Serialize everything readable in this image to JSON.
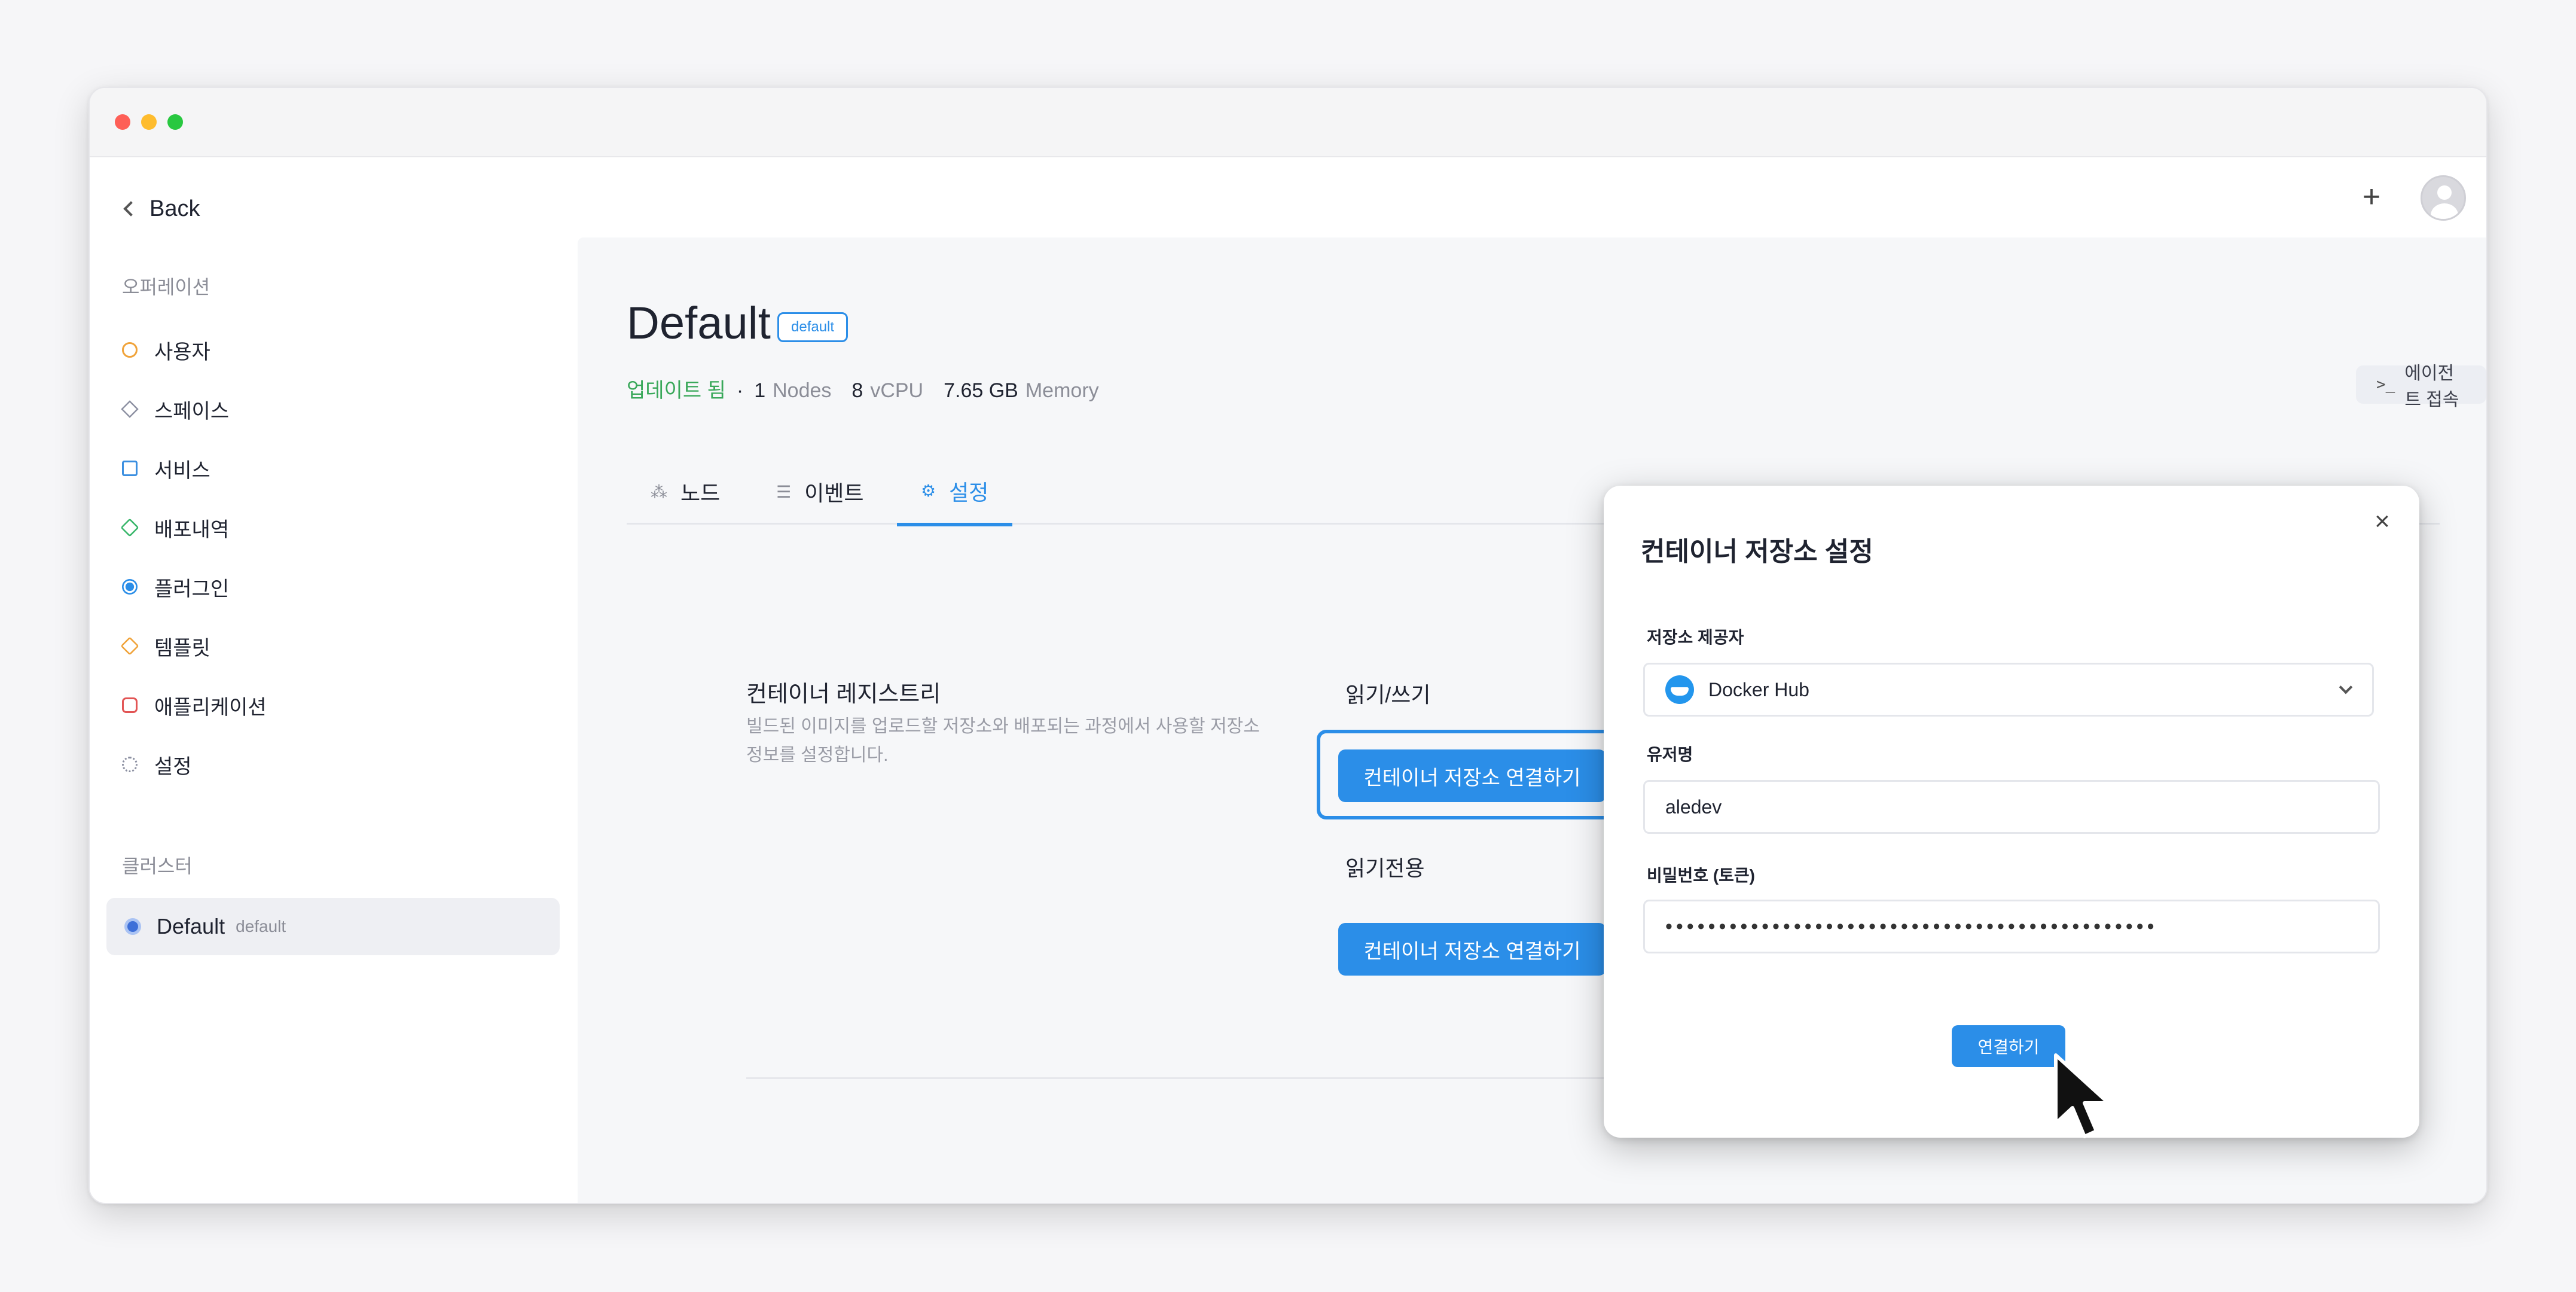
{
  "window": {
    "back_label": "Back",
    "add_icon": "+",
    "avatar_icon": "user-avatar-icon"
  },
  "sidebar": {
    "section_operation": "오퍼레이션",
    "items": [
      {
        "label": "사용자",
        "icon": "users-icon"
      },
      {
        "label": "스페이스",
        "icon": "layers-icon"
      },
      {
        "label": "서비스",
        "icon": "window-icon"
      },
      {
        "label": "배포내역",
        "icon": "package-icon"
      },
      {
        "label": "플러그인",
        "icon": "plugin-icon"
      },
      {
        "label": "템플릿",
        "icon": "box-icon"
      },
      {
        "label": "애플리케이션",
        "icon": "app-icon"
      },
      {
        "label": "설정",
        "icon": "gear-icon"
      }
    ],
    "section_cluster": "클러스터",
    "cluster": {
      "name": "Default",
      "tag": "default",
      "icon": "kubernetes-icon"
    }
  },
  "header": {
    "title": "Default",
    "badge": "default",
    "status": "업데이트 됨",
    "separator": "·",
    "nodes_value": "1",
    "nodes_label": "Nodes",
    "vcpu_value": "8",
    "vcpu_label": "vCPU",
    "memory_value": "7.65 GB",
    "memory_label": "Memory",
    "agent_button": "에이전트 접속",
    "agent_icon": ">_"
  },
  "tabs": [
    {
      "label": "노드",
      "icon": "nodes-icon",
      "active": false
    },
    {
      "label": "이벤트",
      "icon": "list-icon",
      "active": false
    },
    {
      "label": "설정",
      "icon": "gear-icon",
      "active": true
    }
  ],
  "settings": {
    "section_title": "컨테이너 레지스트리",
    "section_desc": "빌드된 이미지를 업로드할 저장소와 배포되는 과정에서 사용할 저장소 정보를 설정합니다.",
    "readwrite_label": "읽기/쓰기",
    "readwrite_button": "컨테이너 저장소 연결하기",
    "readonly_label": "읽기전용",
    "readonly_button": "컨테이너 저장소 연결하기"
  },
  "modal": {
    "title": "컨테이너 저장소 설정",
    "close_icon": "×",
    "provider_label": "저장소 제공자",
    "provider_value": "Docker Hub",
    "username_label": "유저명",
    "username_value": "aledev",
    "password_label": "비밀번호 (토큰)",
    "password_value": "••••••••••••••••••••••••••••••••••••••••••••••",
    "connect_button": "연결하기"
  },
  "colors": {
    "accent": "#2b8ee8",
    "status_green": "#39a85a",
    "muted": "#8b8d97"
  }
}
